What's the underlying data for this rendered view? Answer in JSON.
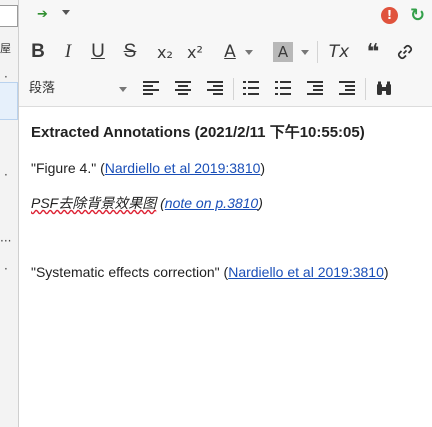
{
  "left_pane": {
    "tab_fragment": "屋",
    "dots": [
      "·",
      "·",
      "···",
      "·"
    ]
  },
  "topbar": {
    "forward_glyph": "➔",
    "error_glyph": "!",
    "sync_glyph": "↻"
  },
  "toolbar": {
    "bold": "B",
    "italic": "I",
    "underline": "U",
    "strike": "S",
    "subscript": "x₂",
    "superscript": "x²",
    "text_color": "A",
    "highlight": "A",
    "clear_format": "Tx",
    "blockquote": "❝",
    "link": "🔗",
    "paragraph_format": "段落",
    "find": "⌕"
  },
  "editor": {
    "heading": "Extracted Annotations (2021/2/11 下午10:55:05)",
    "annotations": [
      {
        "prefix": "\"Figure 4.\" (",
        "citation": "Nardiello et al 2019:3810",
        "suffix": ")"
      },
      {
        "note_text": "PSF去除背景效果图",
        "prefix": " (",
        "citation": "note on p.3810",
        "suffix": ")"
      },
      {
        "prefix": "\"Systematic effects correction\" (",
        "citation": "Nardiello et al 2019:3810",
        "suffix": ")"
      }
    ]
  }
}
